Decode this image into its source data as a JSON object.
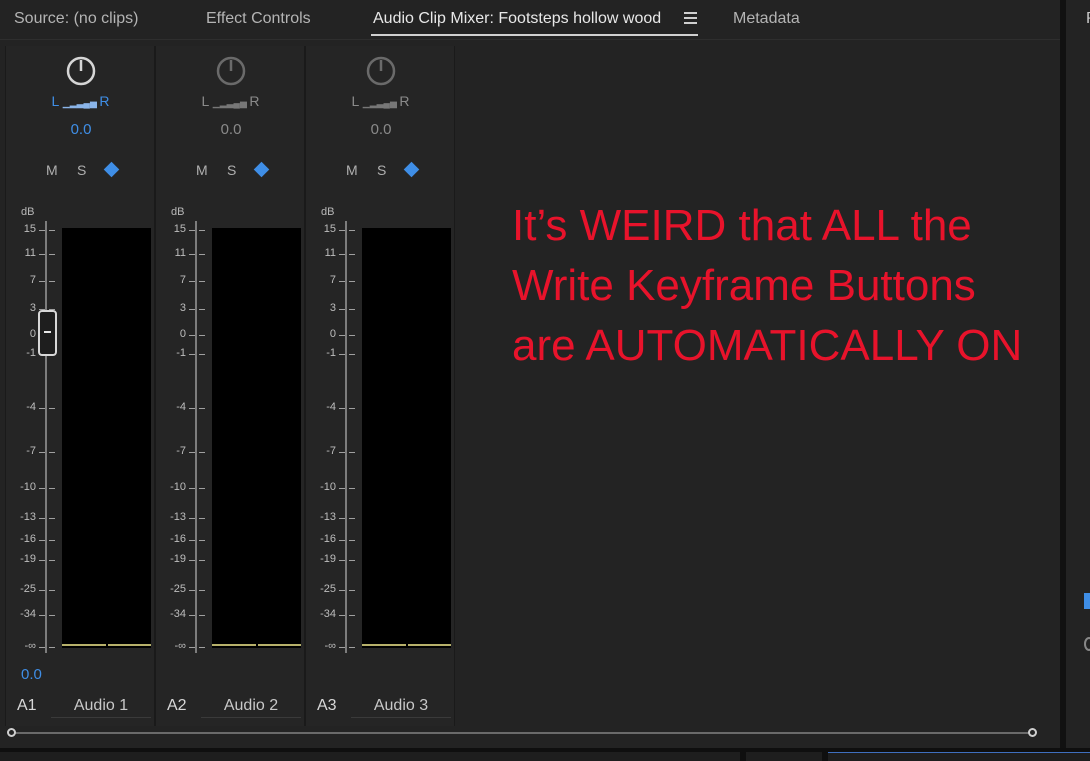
{
  "tabs": [
    {
      "label": "Source: (no clips)",
      "active": false
    },
    {
      "label": "Effect Controls",
      "active": false
    },
    {
      "label": "Audio Clip Mixer: Footsteps hollow wood",
      "active": true
    },
    {
      "label": "Metadata",
      "active": false
    }
  ],
  "right_panel_tab_initial": "P",
  "colors": {
    "accent_blue": "#3f8ee6",
    "annotation_red": "#e8132b",
    "meter_baseline": "#b6b06a"
  },
  "channels": [
    {
      "pan": {
        "l": "L",
        "r": "R",
        "value": "0.0",
        "active": true
      },
      "mute": "M",
      "solo": "S",
      "write_keyframes": true,
      "db_label": "dB",
      "volume": "0.0",
      "show_fader": true,
      "track_id": "A1",
      "track_name": "Audio 1"
    },
    {
      "pan": {
        "l": "L",
        "r": "R",
        "value": "0.0",
        "active": false
      },
      "mute": "M",
      "solo": "S",
      "write_keyframes": true,
      "db_label": "dB",
      "volume": "",
      "show_fader": false,
      "track_id": "A2",
      "track_name": "Audio 2"
    },
    {
      "pan": {
        "l": "L",
        "r": "R",
        "value": "0.0",
        "active": false
      },
      "mute": "M",
      "solo": "S",
      "write_keyframes": true,
      "db_label": "dB",
      "volume": "",
      "show_fader": false,
      "track_id": "A3",
      "track_name": "Audio 3"
    }
  ],
  "scale_ticks": [
    "15",
    "11",
    "7",
    "3",
    "0",
    "-1",
    "-4",
    "-7",
    "-10",
    "-13",
    "-16",
    "-19",
    "-25",
    "-34",
    "-∞"
  ],
  "annotation": {
    "lines": [
      "It’s WEIRD that ALL the",
      "Write Keyframe Buttons",
      "are AUTOMATICALLY ON"
    ]
  }
}
